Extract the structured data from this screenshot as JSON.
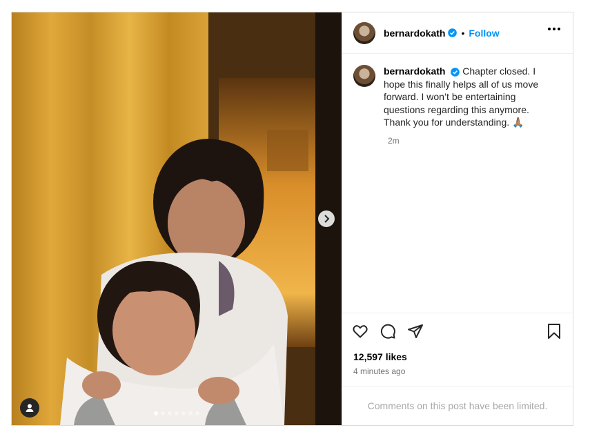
{
  "post": {
    "username": "bernardokath",
    "follow_label": "Follow",
    "separator": "•",
    "caption": "Chapter closed. I hope this finally helps all of us move forward. I won’t be entertaining questions regarding this anymore. Thank you for understanding. 🙏🏽",
    "caption_time": "2m",
    "likes": "12,597 likes",
    "posted_ago": "4 minutes ago",
    "comments_notice": "Comments on this post have been limited.",
    "carousel": {
      "slide_count": 7,
      "active_index": 0
    }
  },
  "icons": {
    "verified": "verified-badge-icon",
    "more": "more-options-icon",
    "like": "heart-icon",
    "comment": "comment-icon",
    "share": "share-icon",
    "save": "bookmark-icon",
    "next": "chevron-right-icon",
    "tag": "user-tag-icon"
  },
  "colors": {
    "accent": "#0095f6",
    "muted": "#737373",
    "limited": "#a8a8a8"
  }
}
